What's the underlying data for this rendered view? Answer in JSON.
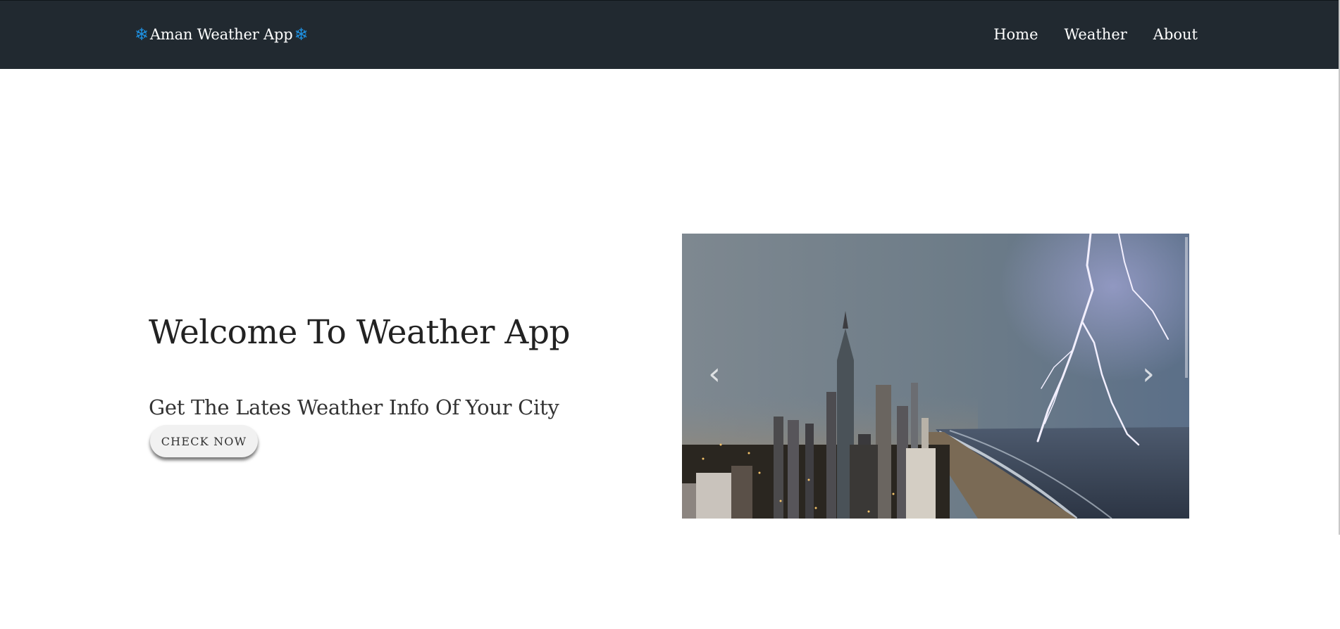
{
  "navbar": {
    "brand_icon_left": "❄",
    "brand_text": "Aman Weather App",
    "brand_icon_right": "❄",
    "links": [
      {
        "label": "Home"
      },
      {
        "label": "Weather"
      },
      {
        "label": "About"
      }
    ],
    "background": "#212930"
  },
  "hero": {
    "title": "Welcome To Weather App",
    "subtitle": "Get The Lates Weather Info Of Your City",
    "cta_label": "CHECK NOW"
  },
  "carousel": {
    "image_alt": "city skyline with lightning storm over the ocean",
    "prev_icon": "‹",
    "next_icon": "›"
  },
  "colors": {
    "accent_icon": "#1e90e0",
    "text_dark": "#222222"
  }
}
